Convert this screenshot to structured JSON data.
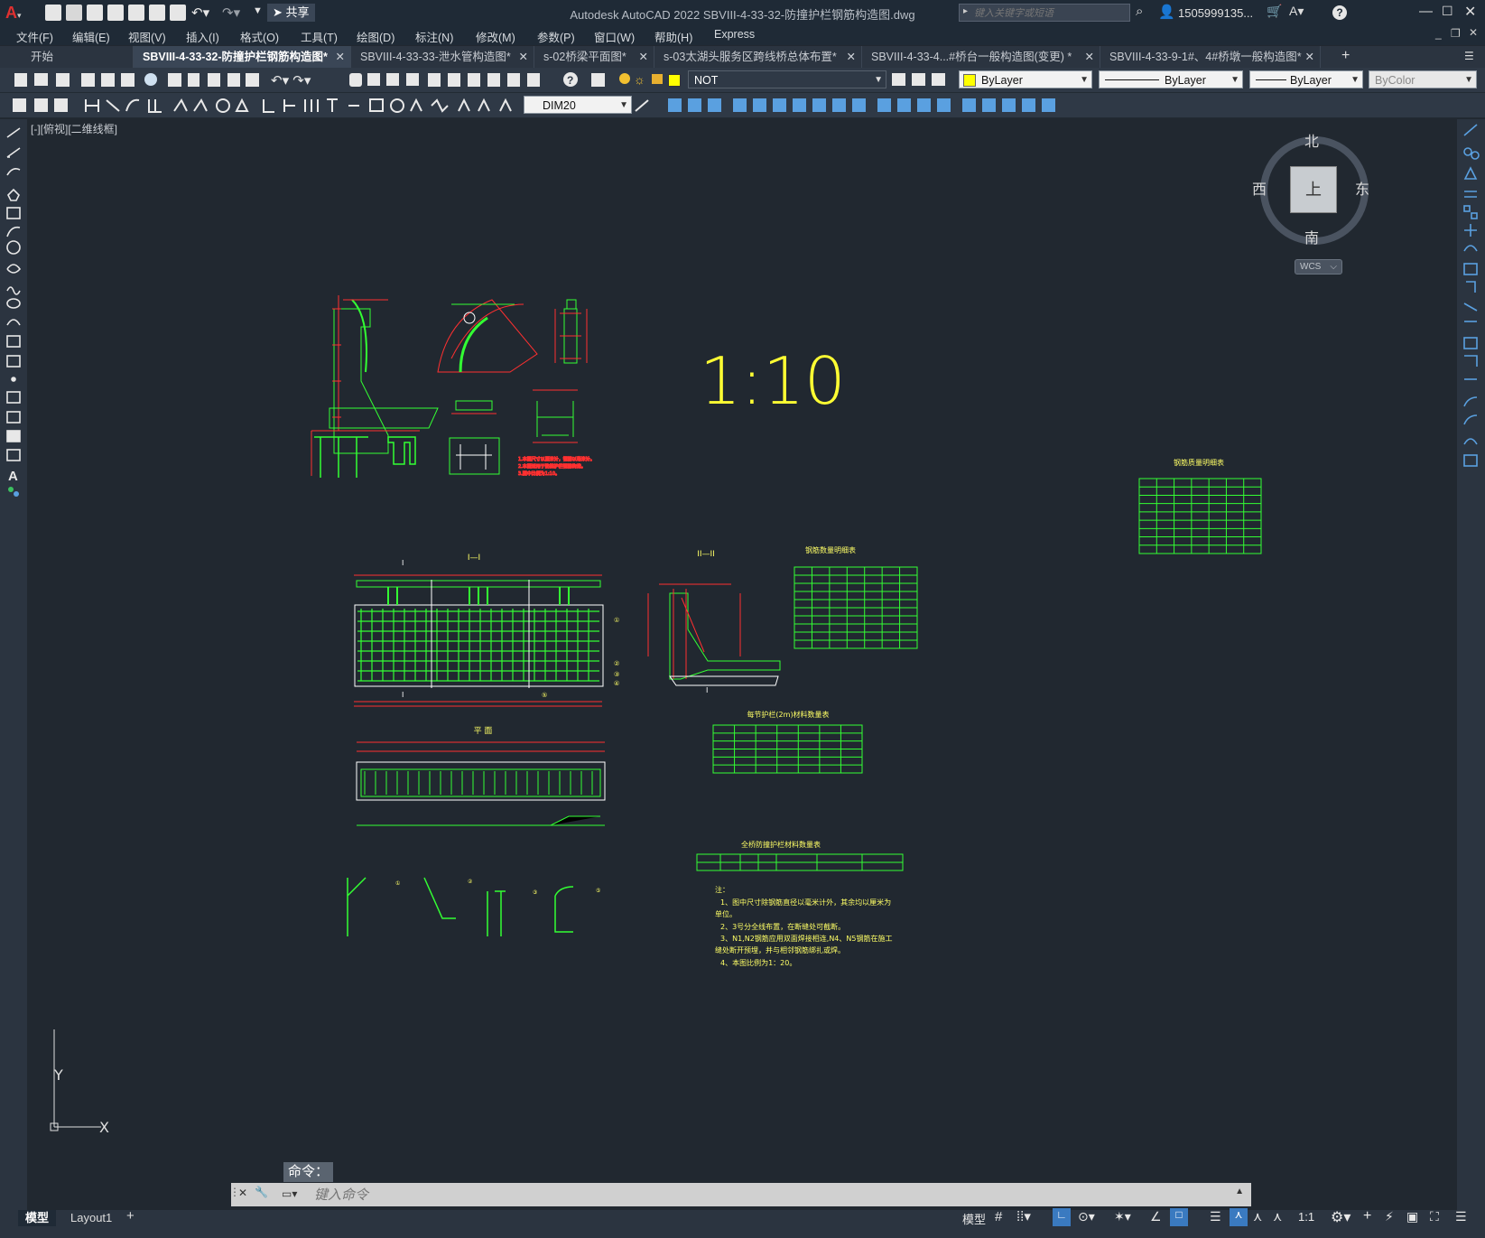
{
  "app": {
    "title": "Autodesk AutoCAD 2022    SBVIII-4-33-32-防撞护栏钢筋构造图.dwg",
    "share_label": "共享",
    "search_placeholder": "键入关键字或短语",
    "user": "1505999135...",
    "help": "?"
  },
  "menu": [
    "文件(F)",
    "编辑(E)",
    "视图(V)",
    "插入(I)",
    "格式(O)",
    "工具(T)",
    "绘图(D)",
    "标注(N)",
    "修改(M)",
    "参数(P)",
    "窗口(W)",
    "帮助(H)",
    "Express"
  ],
  "tabs": [
    "开始",
    "SBVIII-4-33-32-防撞护栏钢筋构造图*",
    "SBVIII-4-33-33-泄水管构造图*",
    "s-02桥梁平面图*",
    "s-03太湖头服务区跨线桥总体布置*",
    "SBVIII-4-33-4...#桥台一般构造图(变更)  *",
    "SBVIII-4-33-9-1#、4#桥墩一般构造图*"
  ],
  "toolbar": {
    "layer": "NOT",
    "color": "ByLayer",
    "linetype": "ByLayer",
    "lineweight": "ByLayer",
    "plotstyle": "ByColor",
    "dimstyle": "DIM20"
  },
  "viewport": {
    "label": "[-][俯视][二维线框]",
    "scale_text": "1:10",
    "viewcube": {
      "north": "北",
      "south": "南",
      "east": "东",
      "west": "西",
      "top": "上",
      "wcs": "WCS"
    },
    "ucs": {
      "x": "X",
      "y": "Y"
    }
  },
  "drawing": {
    "sec1": "I—I",
    "sec2": "II—II",
    "plan": "平  面",
    "marker": "I",
    "marker2": "II",
    "t_header_main": "钢筋数量明细表",
    "t_header_right": "钢筋质量明细表",
    "t_header_2m": "每节护栏(2m)材料数量表",
    "t_header_full": "全桥防撞护栏材料数量表",
    "tbl_main_cols": [
      "编号",
      "直径(mm)",
      "长度(cm)",
      "根数",
      "共长(m)",
      "单位质量(kg/m)",
      "总质量(kg)"
    ],
    "tbl_2m_cols": [
      "类别",
      "规格(mm)",
      "每件长(cm)",
      "件数",
      "总长(m)",
      "质量(kg)",
      "体积(m³)"
    ],
    "note_title": "注：",
    "notes": [
      "1、图中尺寸除钢筋直径以毫米计外，其余均以厘米为",
      "单位。",
      "2、3号分全线布置，在断缝处可截断。",
      "3、N1,N2钢筋应用双面焊接相连,N4、N5钢筋在施工",
      "缝处断开预埋，并与相邻钢筋绑扎或焊。",
      "4、本图比例为1：20。"
    ]
  },
  "command": {
    "history": "命令：",
    "placeholder": "键入命令"
  },
  "layouts": [
    "模型",
    "Layout1"
  ],
  "status": {
    "model": "模型",
    "scale": "1:1"
  }
}
